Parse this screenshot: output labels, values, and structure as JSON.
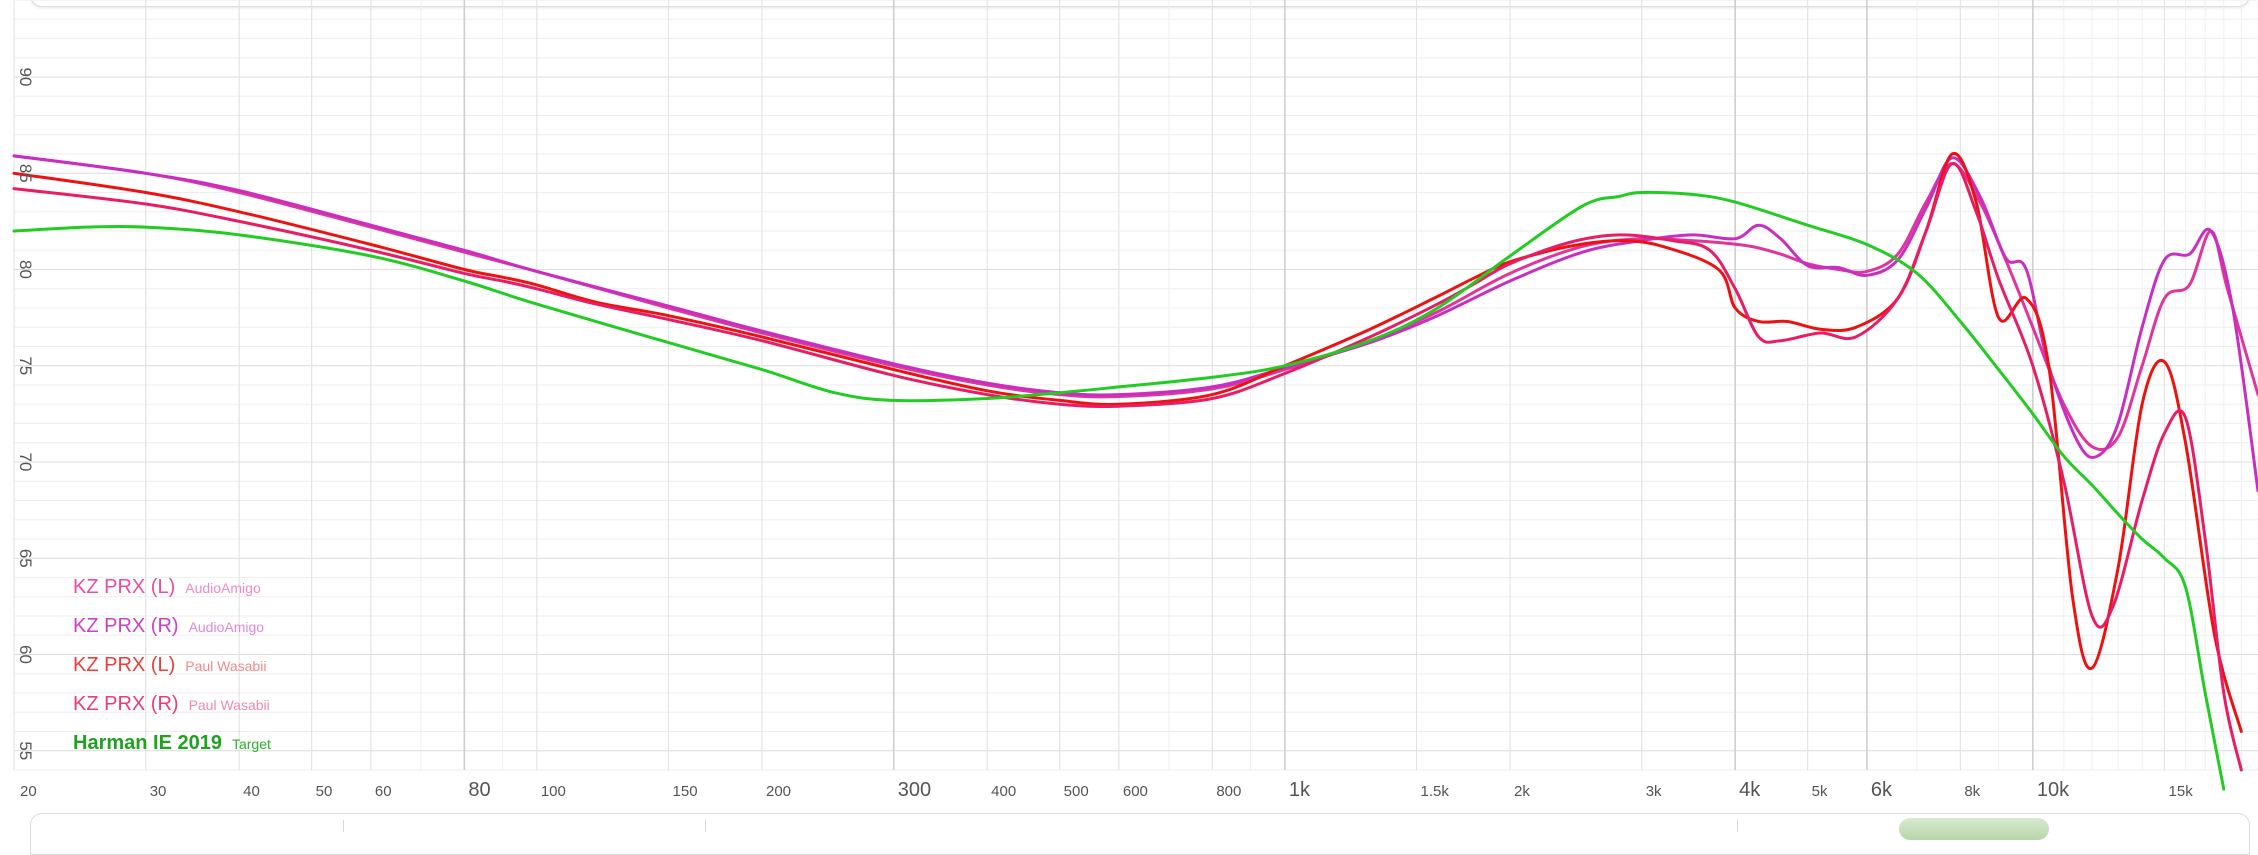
{
  "chart_data": {
    "type": "line",
    "x_scale": "log",
    "xlim": [
      20,
      20000
    ],
    "ylim": [
      54,
      94
    ],
    "grid": true,
    "legend_position": "bottom-left",
    "y_ticks": [
      55,
      60,
      65,
      70,
      75,
      80,
      85,
      90
    ],
    "x_ticks": [
      {
        "value": 20,
        "label": "20",
        "major": false
      },
      {
        "value": 30,
        "label": "30",
        "major": false
      },
      {
        "value": 40,
        "label": "40",
        "major": false
      },
      {
        "value": 50,
        "label": "50",
        "major": false
      },
      {
        "value": 60,
        "label": "60",
        "major": false
      },
      {
        "value": 80,
        "label": "80",
        "major": true
      },
      {
        "value": 100,
        "label": "100",
        "major": false
      },
      {
        "value": 150,
        "label": "150",
        "major": false
      },
      {
        "value": 200,
        "label": "200",
        "major": false
      },
      {
        "value": 300,
        "label": "300",
        "major": true
      },
      {
        "value": 400,
        "label": "400",
        "major": false
      },
      {
        "value": 500,
        "label": "500",
        "major": false
      },
      {
        "value": 600,
        "label": "600",
        "major": false
      },
      {
        "value": 800,
        "label": "800",
        "major": false
      },
      {
        "value": 1000,
        "label": "1k",
        "major": true
      },
      {
        "value": 1500,
        "label": "1.5k",
        "major": false
      },
      {
        "value": 2000,
        "label": "2k",
        "major": false
      },
      {
        "value": 3000,
        "label": "3k",
        "major": false
      },
      {
        "value": 4000,
        "label": "4k",
        "major": true
      },
      {
        "value": 5000,
        "label": "5k",
        "major": false
      },
      {
        "value": 6000,
        "label": "6k",
        "major": true
      },
      {
        "value": 8000,
        "label": "8k",
        "major": false
      },
      {
        "value": 10000,
        "label": "10k",
        "major": true
      },
      {
        "value": 15000,
        "label": "15k",
        "major": false
      }
    ],
    "series": [
      {
        "name": "KZ PRX (L)",
        "source": "AudioAmigo",
        "color": "#e0359d",
        "name_color": "#e64da4",
        "source_color": "#f08ac4",
        "points": [
          [
            20,
            85.9
          ],
          [
            30,
            85.0
          ],
          [
            40,
            84.0
          ],
          [
            60,
            82.2
          ],
          [
            80,
            80.9
          ],
          [
            100,
            79.9
          ],
          [
            150,
            78.0
          ],
          [
            200,
            76.7
          ],
          [
            300,
            75.0
          ],
          [
            400,
            74.0
          ],
          [
            500,
            73.5
          ],
          [
            600,
            73.4
          ],
          [
            800,
            73.8
          ],
          [
            1000,
            74.8
          ],
          [
            1300,
            76.3
          ],
          [
            1600,
            77.8
          ],
          [
            2000,
            79.8
          ],
          [
            2500,
            81.2
          ],
          [
            3000,
            81.6
          ],
          [
            3500,
            81.5
          ],
          [
            3800,
            81.4
          ],
          [
            4200,
            81.2
          ],
          [
            4600,
            80.8
          ],
          [
            5000,
            80.3
          ],
          [
            5500,
            80.0
          ],
          [
            6000,
            79.9
          ],
          [
            6600,
            80.8
          ],
          [
            7200,
            83.5
          ],
          [
            7800,
            85.5
          ],
          [
            8500,
            83.5
          ],
          [
            9200,
            80.5
          ],
          [
            10000,
            77.0
          ],
          [
            11000,
            73.0
          ],
          [
            12000,
            70.8
          ],
          [
            13000,
            71.3
          ],
          [
            14000,
            75.0
          ],
          [
            15000,
            78.5
          ],
          [
            16200,
            79.2
          ],
          [
            17300,
            82.0
          ],
          [
            18200,
            79.0
          ],
          [
            20000,
            73.5
          ]
        ]
      },
      {
        "name": "KZ PRX (R)",
        "source": "AudioAmigo",
        "color": "#c82fc0",
        "name_color": "#cf3fc6",
        "source_color": "#e08ada",
        "points": [
          [
            20,
            85.9
          ],
          [
            30,
            85.0
          ],
          [
            40,
            84.1
          ],
          [
            60,
            82.3
          ],
          [
            80,
            81.0
          ],
          [
            100,
            79.9
          ],
          [
            150,
            78.1
          ],
          [
            200,
            76.8
          ],
          [
            300,
            75.1
          ],
          [
            400,
            74.1
          ],
          [
            500,
            73.6
          ],
          [
            600,
            73.5
          ],
          [
            800,
            73.9
          ],
          [
            1000,
            74.9
          ],
          [
            1300,
            76.2
          ],
          [
            1600,
            77.6
          ],
          [
            2000,
            79.4
          ],
          [
            2500,
            80.9
          ],
          [
            3000,
            81.5
          ],
          [
            3500,
            81.8
          ],
          [
            4000,
            81.6
          ],
          [
            4300,
            82.3
          ],
          [
            4600,
            81.6
          ],
          [
            5000,
            80.2
          ],
          [
            5500,
            80.1
          ],
          [
            6000,
            79.7
          ],
          [
            6600,
            80.5
          ],
          [
            7200,
            83.2
          ],
          [
            7800,
            85.8
          ],
          [
            8500,
            83.8
          ],
          [
            9200,
            80.6
          ],
          [
            9800,
            80.0
          ],
          [
            10500,
            75.0
          ],
          [
            11500,
            71.0
          ],
          [
            12200,
            70.3
          ],
          [
            13000,
            72.0
          ],
          [
            14000,
            77.0
          ],
          [
            15000,
            80.5
          ],
          [
            16200,
            80.8
          ],
          [
            17300,
            82.0
          ],
          [
            18500,
            78.0
          ],
          [
            20000,
            68.5
          ]
        ]
      },
      {
        "name": "KZ PRX (L)",
        "source": "Paul Wasabii",
        "color": "#ee1111",
        "name_color": "#ef3b3b",
        "source_color": "#f08a8a",
        "points": [
          [
            20,
            85.0
          ],
          [
            30,
            84.0
          ],
          [
            40,
            83.0
          ],
          [
            60,
            81.3
          ],
          [
            80,
            80.0
          ],
          [
            90,
            79.6
          ],
          [
            100,
            79.2
          ],
          [
            120,
            78.3
          ],
          [
            150,
            77.6
          ],
          [
            200,
            76.5
          ],
          [
            300,
            74.8
          ],
          [
            400,
            73.7
          ],
          [
            500,
            73.2
          ],
          [
            600,
            73.0
          ],
          [
            800,
            73.5
          ],
          [
            1000,
            75.0
          ],
          [
            1300,
            76.9
          ],
          [
            1600,
            78.6
          ],
          [
            1800,
            79.6
          ],
          [
            2000,
            80.4
          ],
          [
            2400,
            81.2
          ],
          [
            2800,
            81.5
          ],
          [
            3200,
            81.2
          ],
          [
            3800,
            80.0
          ],
          [
            4000,
            78.0
          ],
          [
            4300,
            77.3
          ],
          [
            4700,
            77.3
          ],
          [
            5200,
            76.9
          ],
          [
            5800,
            77.0
          ],
          [
            6600,
            78.5
          ],
          [
            7200,
            82.0
          ],
          [
            7800,
            86.0
          ],
          [
            8400,
            83.5
          ],
          [
            9000,
            77.5
          ],
          [
            9800,
            78.5
          ],
          [
            10500,
            75.0
          ],
          [
            11300,
            63.0
          ],
          [
            12000,
            59.3
          ],
          [
            13000,
            64.5
          ],
          [
            14000,
            73.0
          ],
          [
            15000,
            75.2
          ],
          [
            16000,
            71.0
          ],
          [
            17500,
            61.0
          ],
          [
            19000,
            56.0
          ]
        ]
      },
      {
        "name": "KZ PRX (R)",
        "source": "Paul Wasabii",
        "color": "#e71d66",
        "name_color": "#ea3d77",
        "source_color": "#f08aa9",
        "points": [
          [
            20,
            84.2
          ],
          [
            30,
            83.4
          ],
          [
            40,
            82.5
          ],
          [
            60,
            81.0
          ],
          [
            80,
            79.8
          ],
          [
            90,
            79.4
          ],
          [
            100,
            79.0
          ],
          [
            120,
            78.2
          ],
          [
            150,
            77.4
          ],
          [
            200,
            76.3
          ],
          [
            300,
            74.5
          ],
          [
            400,
            73.5
          ],
          [
            500,
            73.0
          ],
          [
            600,
            72.9
          ],
          [
            800,
            73.3
          ],
          [
            1000,
            74.6
          ],
          [
            1300,
            76.5
          ],
          [
            1600,
            78.2
          ],
          [
            1800,
            79.3
          ],
          [
            2000,
            80.3
          ],
          [
            2400,
            81.4
          ],
          [
            2800,
            81.8
          ],
          [
            3300,
            81.5
          ],
          [
            3700,
            81.0
          ],
          [
            4000,
            79.0
          ],
          [
            4300,
            76.5
          ],
          [
            4600,
            76.3
          ],
          [
            5200,
            76.7
          ],
          [
            5800,
            76.5
          ],
          [
            6600,
            78.5
          ],
          [
            7200,
            82.0
          ],
          [
            7800,
            85.5
          ],
          [
            8400,
            83.0
          ],
          [
            9000,
            79.5
          ],
          [
            10000,
            75.0
          ],
          [
            11000,
            69.0
          ],
          [
            12000,
            62.0
          ],
          [
            12800,
            62.5
          ],
          [
            14000,
            68.0
          ],
          [
            15000,
            71.5
          ],
          [
            16000,
            72.3
          ],
          [
            17000,
            66.0
          ],
          [
            18000,
            58.0
          ],
          [
            19000,
            54.0
          ]
        ]
      },
      {
        "name": "Harman IE 2019",
        "source": "Target",
        "color": "#22cc22",
        "name_color": "#1fa21f",
        "source_color": "#26b526",
        "bold": true,
        "points": [
          [
            20,
            82.0
          ],
          [
            25,
            82.2
          ],
          [
            30,
            82.2
          ],
          [
            40,
            81.8
          ],
          [
            60,
            80.7
          ],
          [
            80,
            79.4
          ],
          [
            100,
            78.2
          ],
          [
            150,
            76.2
          ],
          [
            200,
            74.8
          ],
          [
            250,
            73.6
          ],
          [
            300,
            73.2
          ],
          [
            400,
            73.3
          ],
          [
            500,
            73.6
          ],
          [
            600,
            73.9
          ],
          [
            800,
            74.4
          ],
          [
            1000,
            75.0
          ],
          [
            1300,
            76.3
          ],
          [
            1600,
            78.0
          ],
          [
            2000,
            80.7
          ],
          [
            2500,
            83.3
          ],
          [
            2800,
            83.8
          ],
          [
            3000,
            84.0
          ],
          [
            3500,
            83.9
          ],
          [
            4000,
            83.5
          ],
          [
            5000,
            82.3
          ],
          [
            6000,
            81.3
          ],
          [
            7000,
            79.8
          ],
          [
            8000,
            77.3
          ],
          [
            9000,
            74.8
          ],
          [
            10000,
            72.5
          ],
          [
            11000,
            70.3
          ],
          [
            12000,
            68.8
          ],
          [
            13000,
            67.3
          ],
          [
            14000,
            66.0
          ],
          [
            15000,
            65.0
          ],
          [
            16000,
            63.5
          ],
          [
            17000,
            58.0
          ],
          [
            18000,
            53.0
          ]
        ]
      }
    ]
  }
}
